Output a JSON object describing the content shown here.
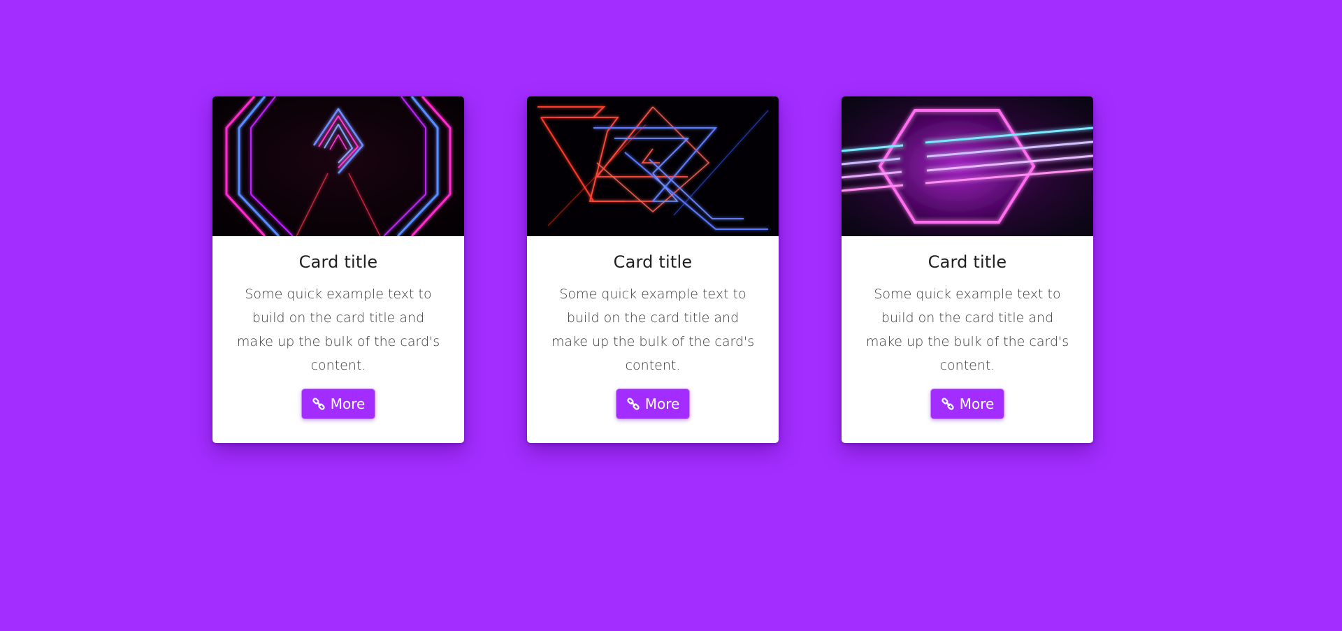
{
  "page": {
    "background_color": "#a32dff"
  },
  "cards": [
    {
      "image": "neon-diamond-tunnel-image",
      "title": "Card title",
      "text": "Some quick example text to build on the card title and make up the bulk of the card's content.",
      "button_icon": "link-icon",
      "button_label": "More"
    },
    {
      "image": "neon-triangles-image",
      "title": "Card title",
      "text": "Some quick example text to build on the card title and make up the bulk of the card's content.",
      "button_icon": "link-icon",
      "button_label": "More"
    },
    {
      "image": "neon-hexagon-image",
      "title": "Card title",
      "text": "Some quick example text to build on the card title and make up the bulk of the card's content.",
      "button_icon": "link-icon",
      "button_label": "More"
    }
  ],
  "colors": {
    "accent": "#a32dff",
    "card_background": "#ffffff",
    "title_text": "#1f1f1f",
    "body_text": "#3b3b3b"
  }
}
